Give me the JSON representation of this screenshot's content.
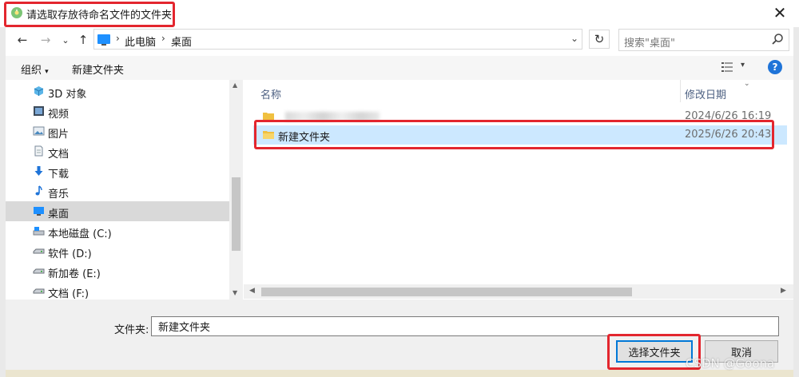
{
  "window": {
    "title": "请选取存放待命名文件的文件夹",
    "close_glyph": "✕"
  },
  "nav": {
    "back_glyph": "←",
    "forward_glyph": "→",
    "recent_glyph": "⌄",
    "up_glyph": "↑",
    "breadcrumb": [
      "此电脑",
      "桌面"
    ],
    "crumb_sep": "›",
    "dropdown_glyph": "⌄",
    "refresh_glyph": "↻",
    "search_placeholder": "搜索\"桌面\""
  },
  "toolbar": {
    "organize_label": "组织",
    "organize_arrow": "▾",
    "new_folder_label": "新建文件夹",
    "view_arrow": "▾",
    "help_glyph": "?"
  },
  "sidebar": {
    "items": [
      {
        "label": "3D 对象",
        "icon": "3d-objects-icon"
      },
      {
        "label": "视频",
        "icon": "video-icon"
      },
      {
        "label": "图片",
        "icon": "pictures-icon"
      },
      {
        "label": "文档",
        "icon": "documents-icon"
      },
      {
        "label": "下载",
        "icon": "download-icon"
      },
      {
        "label": "音乐",
        "icon": "music-icon"
      },
      {
        "label": "桌面",
        "icon": "desktop-icon",
        "selected": true
      },
      {
        "label": "本地磁盘 (C:)",
        "icon": "drive-c-icon"
      },
      {
        "label": "软件 (D:)",
        "icon": "drive-icon"
      },
      {
        "label": "新加卷 (E:)",
        "icon": "drive-icon"
      },
      {
        "label": "文档 (F:)",
        "icon": "drive-icon"
      }
    ]
  },
  "content": {
    "columns": {
      "name": "名称",
      "modified": "修改日期"
    },
    "sort_glyph": "⌄",
    "rows": [
      {
        "name": "",
        "date": "2024/6/26 16:19",
        "blurred": true
      },
      {
        "name": "新建文件夹",
        "date": "2025/6/26 20:43",
        "selected": true
      }
    ]
  },
  "bottom": {
    "folder_label": "文件夹:",
    "folder_value": "新建文件夹",
    "select_button": "选择文件夹",
    "cancel_button": "取消"
  },
  "watermark": "CSDN @Goona",
  "colors": {
    "highlight_red": "#e3262e",
    "selection_blue": "#cce8ff",
    "accent_blue": "#0078d7",
    "folder_yellow": "#f0c040"
  }
}
